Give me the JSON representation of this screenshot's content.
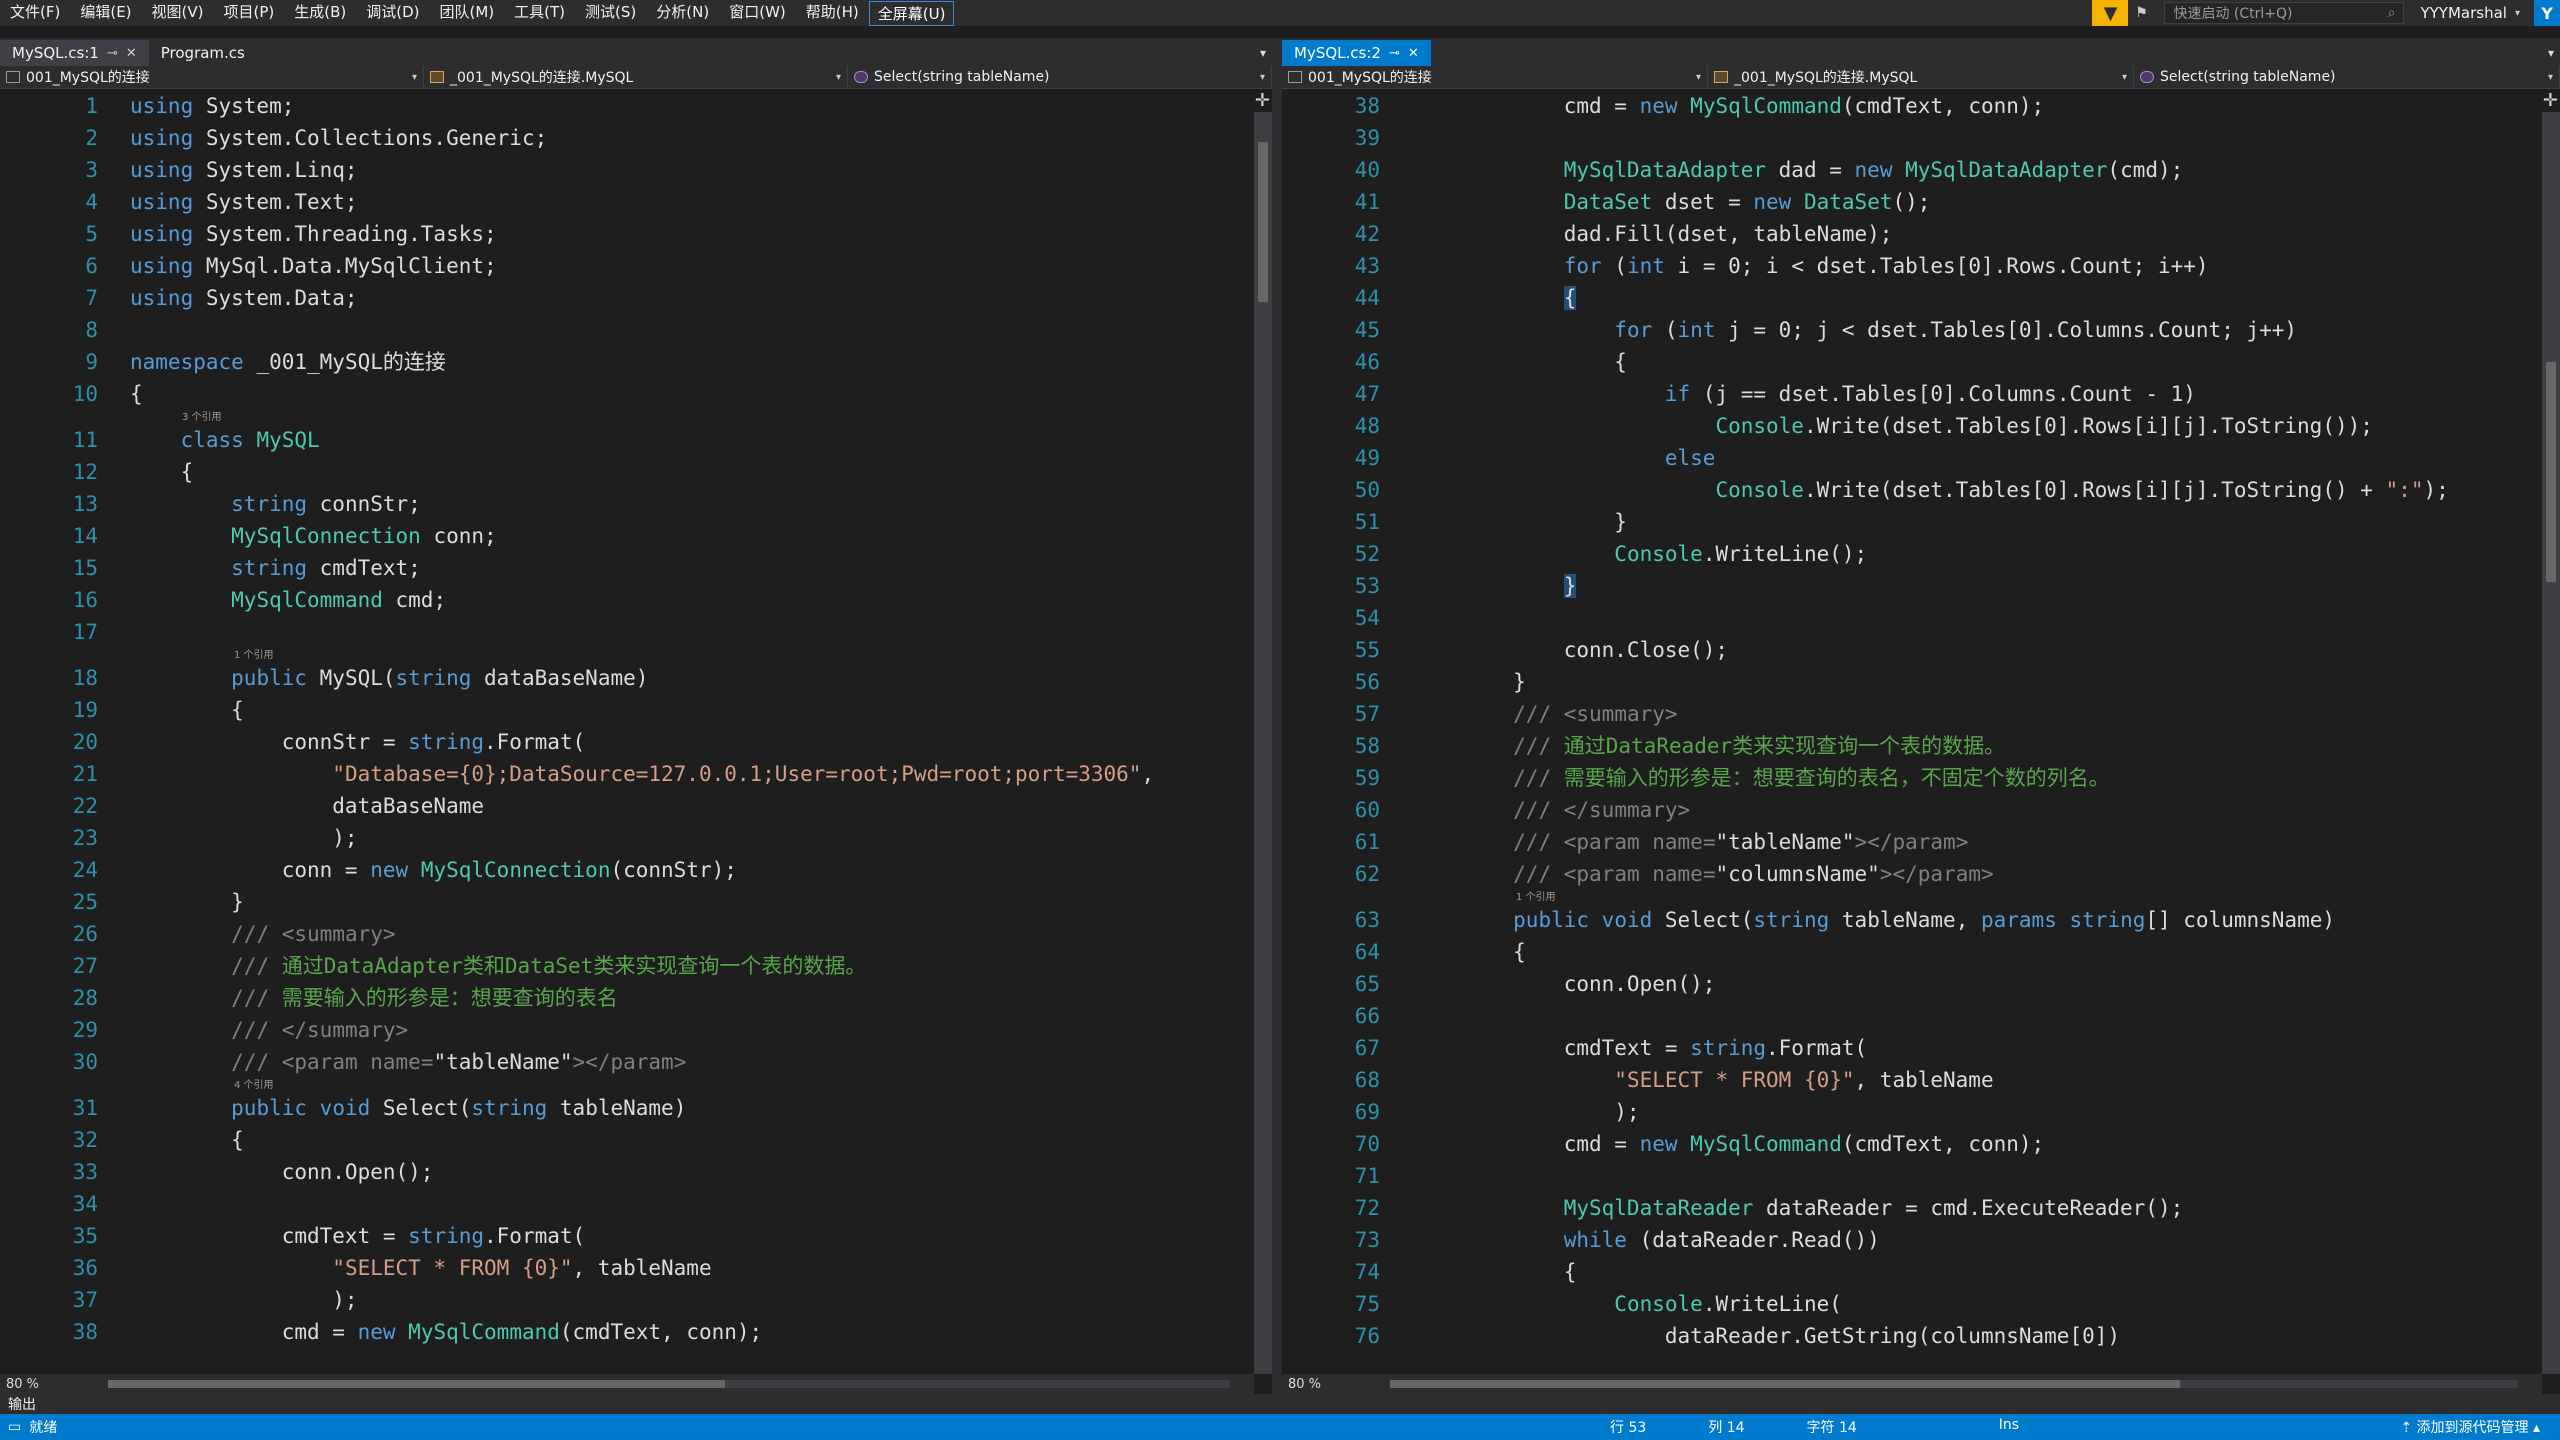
{
  "menubar": {
    "items": [
      "文件(F)",
      "编辑(E)",
      "视图(V)",
      "项目(P)",
      "生成(B)",
      "调试(D)",
      "团队(M)",
      "工具(T)",
      "测试(S)",
      "分析(N)",
      "窗口(W)",
      "帮助(H)",
      "全屏幕(U)"
    ],
    "quick_search_placeholder": "快速启动 (Ctrl+Q)",
    "user_name": "YYYMarshal",
    "user_initial": "Y"
  },
  "left": {
    "tabs": [
      "MySQL.cs:1",
      "Program.cs"
    ],
    "nav": [
      "001_MySQL的连接",
      "_001_MySQL的连接.MySQL",
      "Select(string tableName)"
    ],
    "zoom": "80 %",
    "lines": [
      {
        "n": "1",
        "html": "<span class='kw'>using</span> System;"
      },
      {
        "n": "2",
        "html": "<span class='kw'>using</span> System.Collections.Generic;"
      },
      {
        "n": "3",
        "html": "<span class='kw'>using</span> System.Linq;"
      },
      {
        "n": "4",
        "html": "<span class='kw'>using</span> System.Text;"
      },
      {
        "n": "5",
        "html": "<span class='kw'>using</span> System.Threading.Tasks;"
      },
      {
        "n": "6",
        "html": "<span class='kw'>using</span> MySql.Data.MySqlClient;"
      },
      {
        "n": "7",
        "html": "<span class='kw'>using</span> System.Data;"
      },
      {
        "n": "8",
        "html": ""
      },
      {
        "n": "9",
        "html": "<span class='kw'>namespace</span> _001_MySQL的连接"
      },
      {
        "n": "10",
        "html": "{"
      },
      {
        "n": "11",
        "html": "    <span class='kw'>class</span> <span class='ty'>MySQL</span>",
        "lens": "3 个引用"
      },
      {
        "n": "12",
        "html": "    {"
      },
      {
        "n": "13",
        "html": "        <span class='kw'>string</span> connStr;"
      },
      {
        "n": "14",
        "html": "        <span class='ty'>MySqlConnection</span> conn;"
      },
      {
        "n": "15",
        "html": "        <span class='kw'>string</span> cmdText;"
      },
      {
        "n": "16",
        "html": "        <span class='ty'>MySqlCommand</span> cmd;"
      },
      {
        "n": "17",
        "html": ""
      },
      {
        "n": "18",
        "html": "        <span class='kw'>public</span> MySQL(<span class='kw'>string</span> dataBaseName)",
        "lens": "1 个引用"
      },
      {
        "n": "19",
        "html": "        {"
      },
      {
        "n": "20",
        "html": "            connStr = <span class='kw'>string</span>.Format("
      },
      {
        "n": "21",
        "html": "                <span class='st'>\"Database={0};DataSource=127.0.0.1;User=root;Pwd=root;port=3306\"</span>,"
      },
      {
        "n": "22",
        "html": "                dataBaseName"
      },
      {
        "n": "23",
        "html": "                );"
      },
      {
        "n": "24",
        "html": "            conn = <span class='kw'>new</span> <span class='ty'>MySqlConnection</span>(connStr);"
      },
      {
        "n": "25",
        "html": "        }"
      },
      {
        "n": "26",
        "html": "        <span class='tag'>///</span> <span class='tag'>&lt;summary&gt;</span>"
      },
      {
        "n": "27",
        "html": "        <span class='tag'>///</span> <span class='cm'>通过DataAdapter类和DataSet类来实现查询一个表的数据。</span>"
      },
      {
        "n": "28",
        "html": "        <span class='tag'>///</span> <span class='cm'>需要输入的形参是：想要查询的表名</span>"
      },
      {
        "n": "29",
        "html": "        <span class='tag'>///</span> <span class='tag'>&lt;/summary&gt;</span>"
      },
      {
        "n": "30",
        "html": "        <span class='tag'>///</span> <span class='tag'>&lt;param name=</span>\"tableName\"<span class='tag'>&gt;&lt;/param&gt;</span>"
      },
      {
        "n": "31",
        "html": "        <span class='kw'>public</span> <span class='kw'>void</span> Select(<span class='kw'>string</span> tableName)",
        "lens": "4 个引用"
      },
      {
        "n": "32",
        "html": "        {"
      },
      {
        "n": "33",
        "html": "            conn.Open();"
      },
      {
        "n": "34",
        "html": ""
      },
      {
        "n": "35",
        "html": "            cmdText = <span class='kw'>string</span>.Format("
      },
      {
        "n": "36",
        "html": "                <span class='st'>\"SELECT * FROM {0}\"</span>, tableName"
      },
      {
        "n": "37",
        "html": "                );"
      },
      {
        "n": "38",
        "html": "            cmd = <span class='kw'>new</span> <span class='ty'>MySqlCommand</span>(cmdText, conn);"
      }
    ]
  },
  "right": {
    "tabs": [
      "MySQL.cs:2"
    ],
    "nav": [
      "001_MySQL的连接",
      "_001_MySQL的连接.MySQL",
      "Select(string tableName)"
    ],
    "zoom": "80 %",
    "lines": [
      {
        "n": "38",
        "html": "            cmd = <span class='kw'>new</span> <span class='ty'>MySqlCommand</span>(cmdText, conn);"
      },
      {
        "n": "39",
        "html": ""
      },
      {
        "n": "40",
        "html": "            <span class='ty'>MySqlDataAdapter</span> dad = <span class='kw'>new</span> <span class='ty'>MySqlDataAdapter</span>(cmd);"
      },
      {
        "n": "41",
        "html": "            <span class='ty'>DataSet</span> dset = <span class='kw'>new</span> <span class='ty'>DataSet</span>();"
      },
      {
        "n": "42",
        "html": "            dad.Fill(dset, tableName);"
      },
      {
        "n": "43",
        "html": "            <span class='kw'>for</span> (<span class='kw'>int</span> i = 0; i &lt; dset.Tables[0].Rows.Count; i++)"
      },
      {
        "n": "44",
        "html": "            <span class='cur'>{</span>"
      },
      {
        "n": "45",
        "html": "                <span class='kw'>for</span> (<span class='kw'>int</span> j = 0; j &lt; dset.Tables[0].Columns.Count; j++)"
      },
      {
        "n": "46",
        "html": "                {"
      },
      {
        "n": "47",
        "html": "                    <span class='kw'>if</span> (j == dset.Tables[0].Columns.Count - 1)"
      },
      {
        "n": "48",
        "html": "                        <span class='ty'>Console</span>.Write(dset.Tables[0].Rows[i][j].ToString());"
      },
      {
        "n": "49",
        "html": "                    <span class='kw'>else</span>"
      },
      {
        "n": "50",
        "html": "                        <span class='ty'>Console</span>.Write(dset.Tables[0].Rows[i][j].ToString() + <span class='st'>\":\"</span>);"
      },
      {
        "n": "51",
        "html": "                }"
      },
      {
        "n": "52",
        "html": "                <span class='ty'>Console</span>.WriteLine();"
      },
      {
        "n": "53",
        "html": "            <span class='cur'>}</span>"
      },
      {
        "n": "54",
        "html": ""
      },
      {
        "n": "55",
        "html": "            conn.Close();"
      },
      {
        "n": "56",
        "html": "        }"
      },
      {
        "n": "57",
        "html": "        <span class='tag'>///</span> <span class='tag'>&lt;summary&gt;</span>"
      },
      {
        "n": "58",
        "html": "        <span class='tag'>///</span> <span class='cm'>通过DataReader类来实现查询一个表的数据。</span>"
      },
      {
        "n": "59",
        "html": "        <span class='tag'>///</span> <span class='cm'>需要输入的形参是：想要查询的表名，不固定个数的列名。</span>"
      },
      {
        "n": "60",
        "html": "        <span class='tag'>///</span> <span class='tag'>&lt;/summary&gt;</span>"
      },
      {
        "n": "61",
        "html": "        <span class='tag'>///</span> <span class='tag'>&lt;param name=</span>\"tableName\"<span class='tag'>&gt;&lt;/param&gt;</span>"
      },
      {
        "n": "62",
        "html": "        <span class='tag'>///</span> <span class='tag'>&lt;param name=</span>\"columnsName\"<span class='tag'>&gt;&lt;/param&gt;</span>"
      },
      {
        "n": "63",
        "html": "        <span class='kw'>public</span> <span class='kw'>void</span> Select(<span class='kw'>string</span> tableName, <span class='kw'>params</span> <span class='kw'>string</span>[] columnsName)",
        "lens": "1 个引用"
      },
      {
        "n": "64",
        "html": "        {"
      },
      {
        "n": "65",
        "html": "            conn.Open();"
      },
      {
        "n": "66",
        "html": ""
      },
      {
        "n": "67",
        "html": "            cmdText = <span class='kw'>string</span>.Format("
      },
      {
        "n": "68",
        "html": "                <span class='st'>\"SELECT * FROM {0}\"</span>, tableName"
      },
      {
        "n": "69",
        "html": "                );"
      },
      {
        "n": "70",
        "html": "            cmd = <span class='kw'>new</span> <span class='ty'>MySqlCommand</span>(cmdText, conn);"
      },
      {
        "n": "71",
        "html": ""
      },
      {
        "n": "72",
        "html": "            <span class='ty'>MySqlDataReader</span> dataReader = cmd.ExecuteReader();"
      },
      {
        "n": "73",
        "html": "            <span class='kw'>while</span> (dataReader.Read())"
      },
      {
        "n": "74",
        "html": "            {"
      },
      {
        "n": "75",
        "html": "                <span class='ty'>Console</span>.WriteLine("
      },
      {
        "n": "76",
        "html": "                    dataReader.GetString(columnsName[0])"
      }
    ]
  },
  "output_label": "输出",
  "status": {
    "ready": "就绪",
    "line": "行 53",
    "col": "列 14",
    "char": "字符 14",
    "mode": "Ins",
    "source_control": "添加到源代码管理"
  },
  "colors": {
    "accent": "#007acc",
    "keyword": "#569cd6",
    "type": "#4ec9b0",
    "string": "#d69d85",
    "comment": "#57a64a"
  }
}
